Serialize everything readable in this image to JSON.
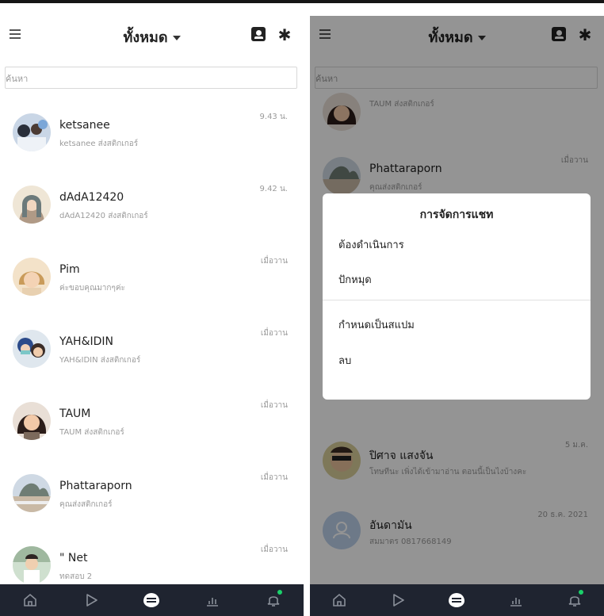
{
  "header": {
    "title": "ทั้งหมด"
  },
  "search": {
    "placeholder": "ค้นหา"
  },
  "left_list": [
    {
      "name": "ketsanee",
      "sub": "ketsanee ส่งสติกเกอร์",
      "time": "9.43 น."
    },
    {
      "name": "dAdA12420",
      "sub": "dAdA12420 ส่งสติกเกอร์",
      "time": "9.42 น."
    },
    {
      "name": "Pim",
      "sub": "ค่ะขอบคุณมากๆค่ะ",
      "time": "เมื่อวาน"
    },
    {
      "name": "YAH&IDIN",
      "sub": "YAH&IDIN ส่งสติกเกอร์",
      "time": "เมื่อวาน"
    },
    {
      "name": "TAUM",
      "sub": "TAUM ส่งสติกเกอร์",
      "time": "เมื่อวาน"
    },
    {
      "name": "Phattaraporn",
      "sub": "คุณส่งสติกเกอร์",
      "time": "เมื่อวาน"
    },
    {
      "name": "\" Net",
      "sub": "ทดสอบ 2",
      "time": "เมื่อวาน"
    }
  ],
  "right_list": [
    {
      "name": "",
      "sub": "TAUM ส่งสติกเกอร์",
      "time": ""
    },
    {
      "name": "Phattaraporn",
      "sub": "คุณส่งสติกเกอร์",
      "time": "เมื่อวาน"
    },
    {
      "name": "ปิศาจ แสงจัน",
      "sub": "โทษทีนะ เพิ่งได้เข้ามาอ่าน ตอนนี้เป็นไงบ้างคะ",
      "time": "5 ม.ค."
    },
    {
      "name": "อันดามัน",
      "sub": "สมมาตร 0817668149",
      "time": "20 ธ.ค. 2021"
    }
  ],
  "modal": {
    "title": "การจัดการแชท",
    "items": [
      "ต้องดำเนินการ",
      "ปักหมุด",
      "กำหนดเป็นสแปม",
      "ลบ"
    ]
  },
  "icons": {
    "menu": "hamburger-icon",
    "contacts": "contact-icon",
    "settings": "gear-icon",
    "home": "home-icon",
    "play": "play-icon",
    "chat": "chat-icon",
    "stats": "stats-icon",
    "bell": "bell-icon"
  },
  "colors": {
    "nav_bg": "#1f2430",
    "badge": "#1ad16a",
    "overlay": "rgba(0,0,0,0.42)"
  }
}
